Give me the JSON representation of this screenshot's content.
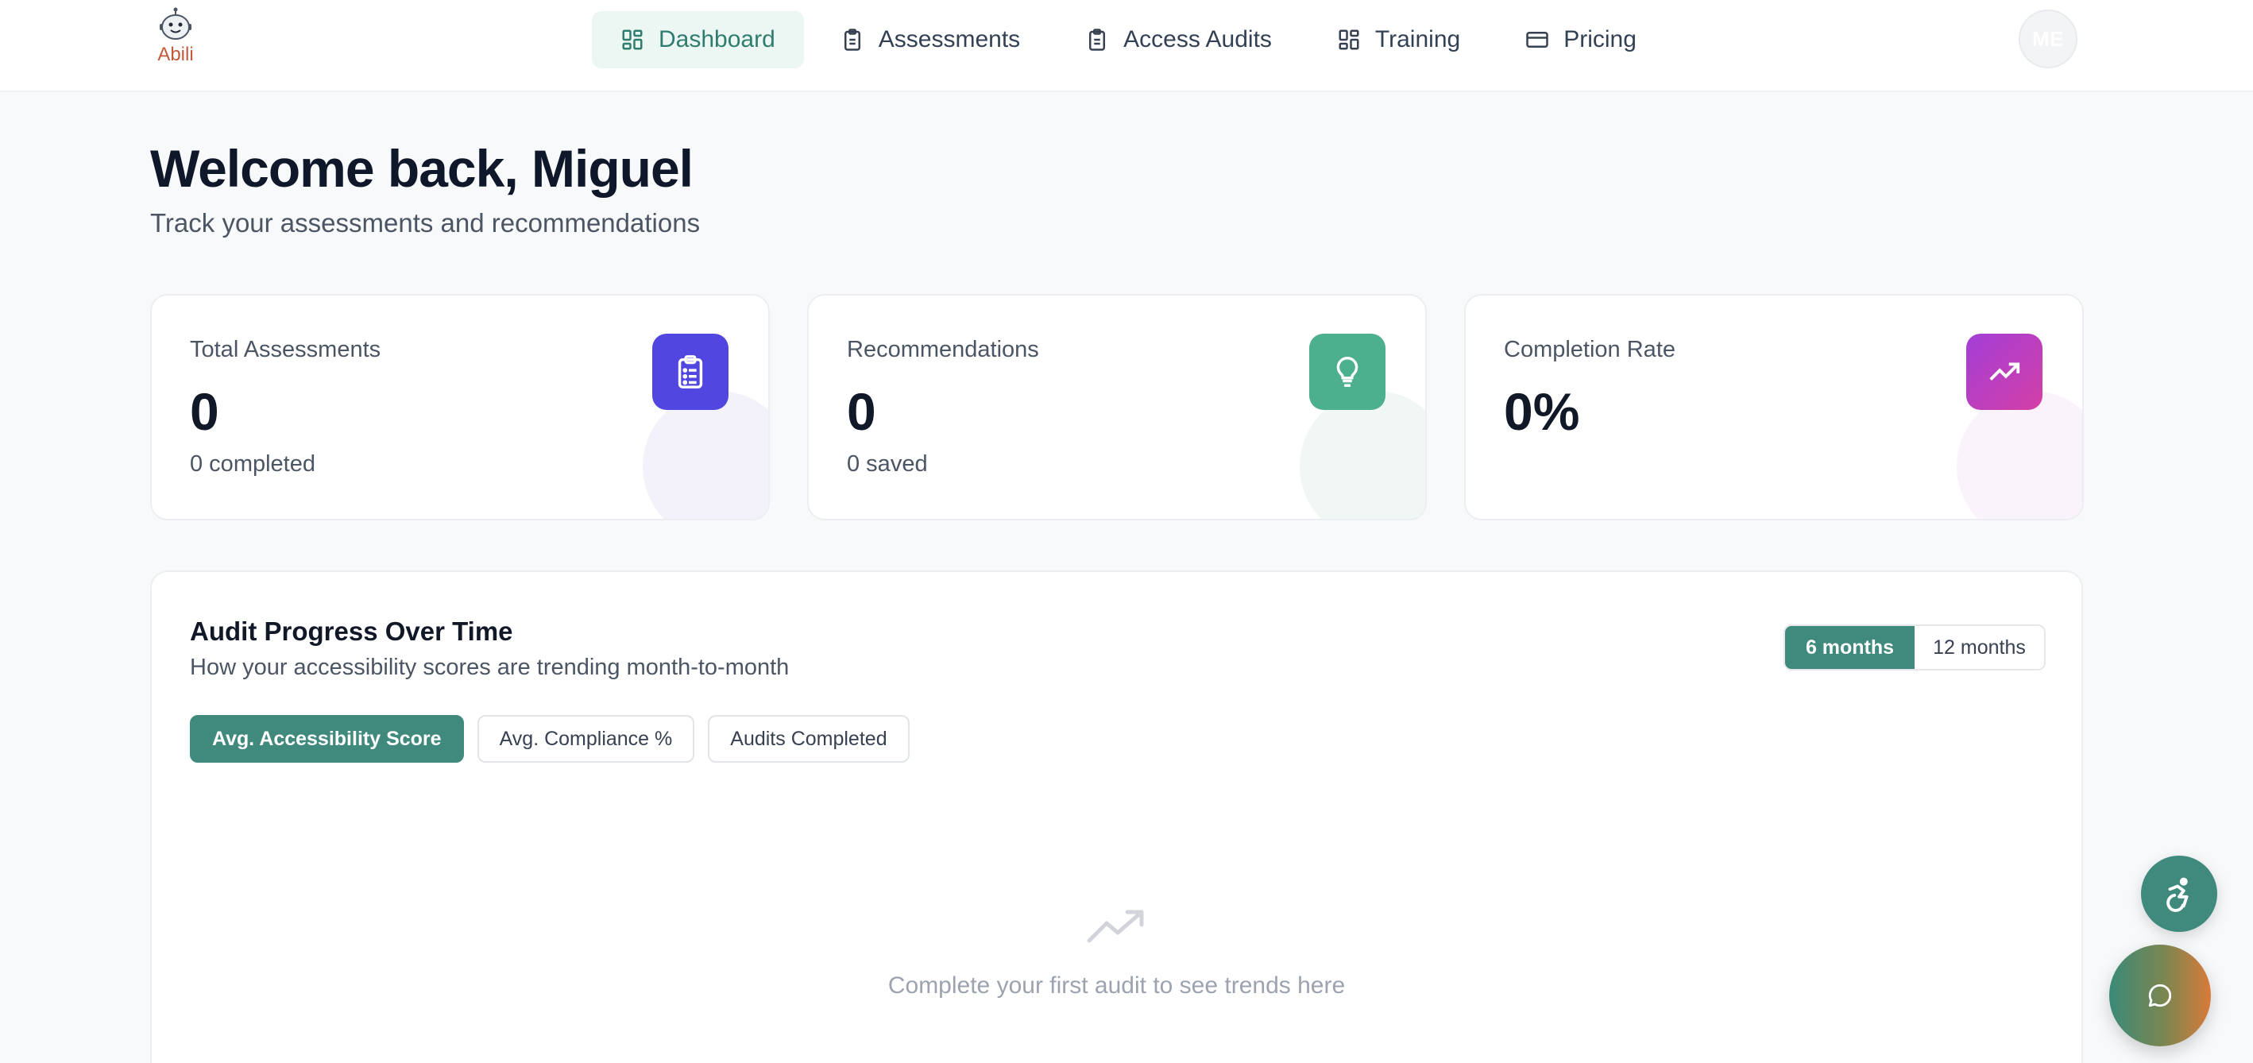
{
  "app": {
    "logo_text": "Abili"
  },
  "nav": {
    "items": [
      {
        "label": "Dashboard",
        "icon": "dashboard-grid-icon",
        "active": true
      },
      {
        "label": "Assessments",
        "icon": "clipboard-icon",
        "active": false
      },
      {
        "label": "Access Audits",
        "icon": "clipboard-icon",
        "active": false
      },
      {
        "label": "Training",
        "icon": "grid-icon",
        "active": false
      },
      {
        "label": "Pricing",
        "icon": "credit-card-icon",
        "active": false
      }
    ]
  },
  "user": {
    "initials": "ME"
  },
  "welcome": {
    "title": "Welcome back, Miguel",
    "subtitle": "Track your assessments and recommendations"
  },
  "stats": [
    {
      "label": "Total Assessments",
      "value": "0",
      "sub": "0 completed",
      "icon": "clipboard-list-icon",
      "color": "#5146e0"
    },
    {
      "label": "Recommendations",
      "value": "0",
      "sub": "0 saved",
      "icon": "lightbulb-icon",
      "color": "#4caf8e"
    },
    {
      "label": "Completion Rate",
      "value": "0%",
      "sub": "",
      "icon": "trending-up-icon",
      "color": "#c03fcf"
    }
  ],
  "audit_progress": {
    "title": "Audit Progress Over Time",
    "subtitle": "How your accessibility scores are trending month-to-month",
    "ranges": [
      {
        "label": "6 months",
        "active": true
      },
      {
        "label": "12 months",
        "active": false
      }
    ],
    "metrics": [
      {
        "label": "Avg. Accessibility Score",
        "active": true
      },
      {
        "label": "Avg. Compliance %",
        "active": false
      },
      {
        "label": "Audits Completed",
        "active": false
      }
    ],
    "empty_message": "Complete your first audit to see trends here"
  },
  "colors": {
    "accent": "#3f8a7d",
    "background": "#f8f9fa"
  }
}
